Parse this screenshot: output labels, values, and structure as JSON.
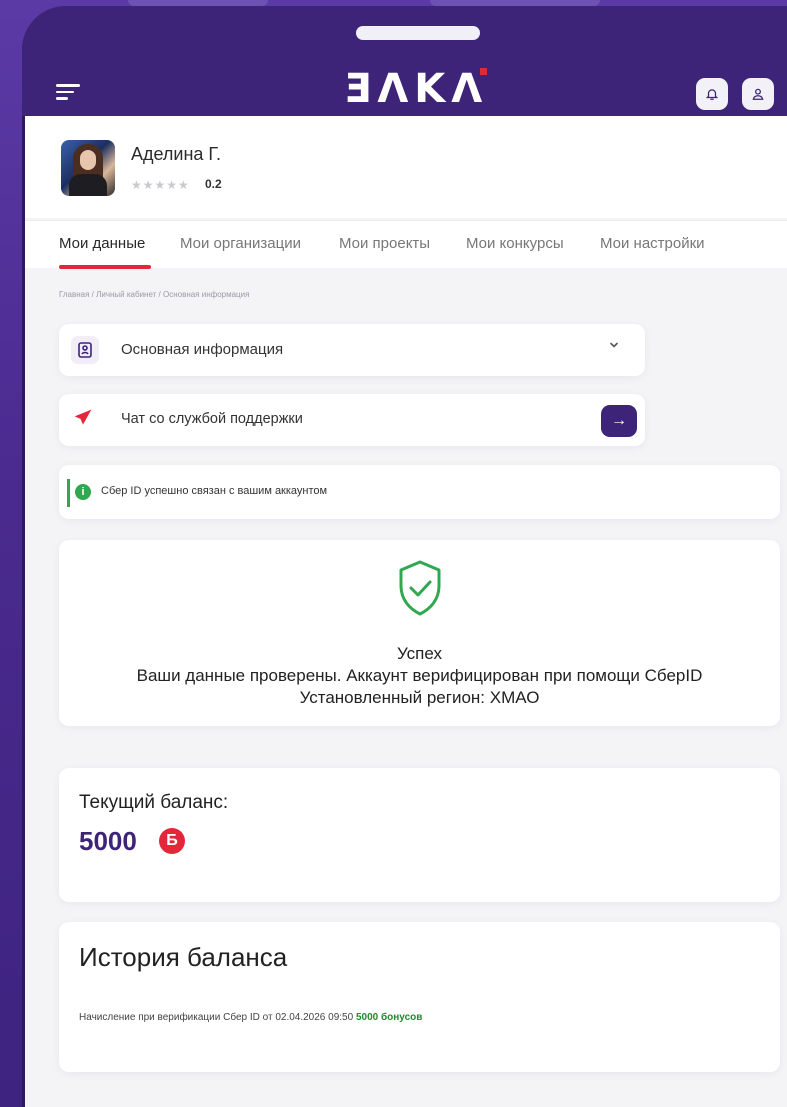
{
  "header": {
    "logo_text": "ƎΛKΛ",
    "logo_accent": "#e4263a",
    "menu_icon": "hamburger-icon",
    "bell_icon": "bell-icon",
    "user_icon": "user-icon"
  },
  "profile": {
    "name": "Аделина Г.",
    "stars": "★★★★★",
    "rating": "0.2"
  },
  "tabs": [
    {
      "label": "Мои данные",
      "active": true
    },
    {
      "label": "Мои организации"
    },
    {
      "label": "Мои проекты"
    },
    {
      "label": "Мои конкурсы"
    },
    {
      "label": "Мои настройки"
    }
  ],
  "breadcrumb": "Главная / Личный кабинет / Основная информация",
  "accordion": {
    "main_info": "Основная информация",
    "support_chat": "Чат со службой поддержки"
  },
  "notice": {
    "text": "Сбер ID успешно связан с вашим аккаунтом",
    "color": "#2fa84f"
  },
  "verification": {
    "title": "Успех",
    "message": "Ваши данные проверены. Аккаунт верифицирован при помощи СберID",
    "region": "Установленный регион: ХМАО"
  },
  "balance": {
    "label": "Текущий баланс:",
    "value": "5000",
    "currency_symbol": "Б"
  },
  "history": {
    "title": "История баланса",
    "entry_text": "Начисление при верификации Сбер ID от 02.04.2026 09:50",
    "entry_amount": "5000 бонусов"
  },
  "colors": {
    "brand": "#3d2478",
    "accent": "#e4263a",
    "success": "#2fa84f"
  }
}
